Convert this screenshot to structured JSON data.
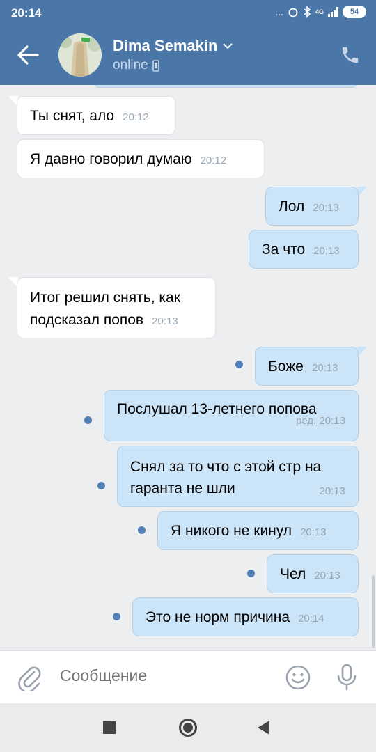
{
  "status_bar": {
    "time": "20:14",
    "dots": "...",
    "network": "4G",
    "battery": "54"
  },
  "header": {
    "contact_name": "Dima Semakin",
    "contact_status": "online"
  },
  "messages": [
    {
      "dir": "in",
      "text": "Ты снят, ало",
      "time": "20:12"
    },
    {
      "dir": "in",
      "text": "Я давно говорил думаю",
      "time": "20:12"
    },
    {
      "dir": "out",
      "text": "Лол",
      "time": "20:13"
    },
    {
      "dir": "out",
      "text": "За что",
      "time": "20:13"
    },
    {
      "dir": "in",
      "text": "Итог решил снять, как подсказал попов",
      "time": "20:13"
    },
    {
      "dir": "out",
      "text": "Боже",
      "time": "20:13",
      "unread": true
    },
    {
      "dir": "out",
      "text": "Послушал 13-летнего попова",
      "time": "ред. 20:13",
      "unread": true
    },
    {
      "dir": "out",
      "text": "Снял за то что с этой стр на гаранта не шли",
      "time": "20:13",
      "unread": true
    },
    {
      "dir": "out",
      "text": "Я никого не кинул",
      "time": "20:13",
      "unread": true
    },
    {
      "dir": "out",
      "text": "Чел",
      "time": "20:13",
      "unread": true
    },
    {
      "dir": "out",
      "text": "Это не норм причина",
      "time": "20:14",
      "unread": true
    }
  ],
  "input": {
    "placeholder": "Сообщение"
  },
  "colors": {
    "header": "#4a76a8",
    "incoming_bubble": "#ffffff",
    "outgoing_bubble": "#cce4f7",
    "background": "#edeef0",
    "unread_dot": "#5181b8"
  },
  "icons": [
    "back-arrow-icon",
    "chevron-down-icon",
    "mobile-icon",
    "phone-icon",
    "attach-icon",
    "emoji-icon",
    "mic-icon",
    "nav-recents-icon",
    "nav-home-icon",
    "nav-back-icon"
  ]
}
